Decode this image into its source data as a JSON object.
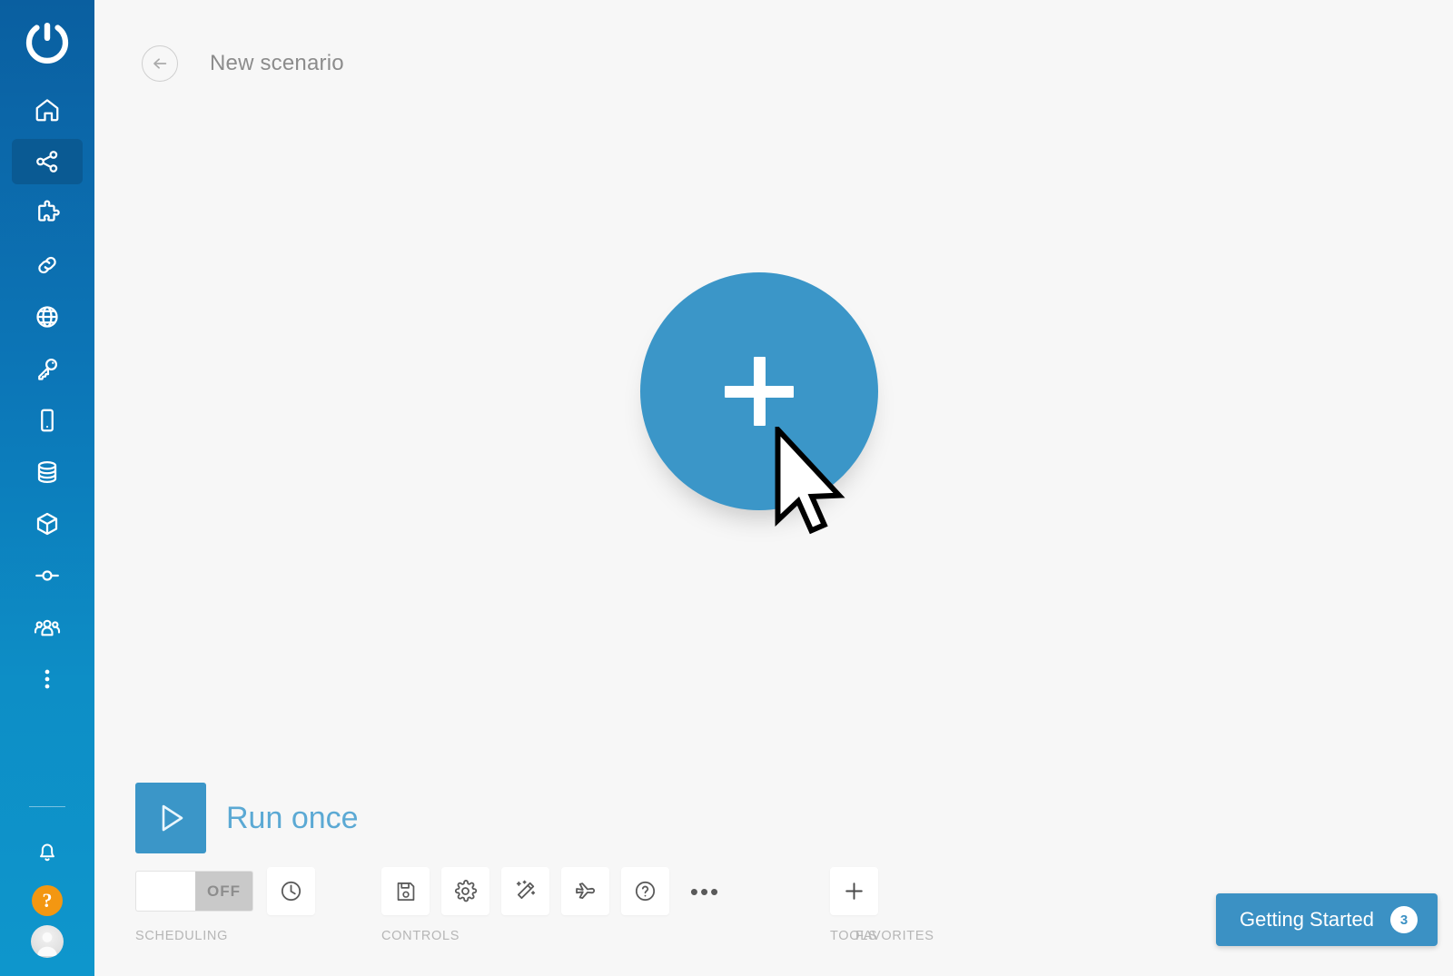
{
  "colors": {
    "brand_blue": "#0c77b8",
    "accent_blue": "#3b96c8",
    "sidebar_active": "#0a5a93",
    "help_orange": "#f39711",
    "canvas_bg": "#f7f7f7",
    "muted_text": "#b6b6b6",
    "title_text": "#8c8c8c",
    "run_label": "#5ba9d4"
  },
  "sidebar": {
    "logo": "integromat-power-logo",
    "items": [
      {
        "name": "home",
        "icon": "home-icon",
        "active": false
      },
      {
        "name": "scenarios",
        "icon": "share-nodes-icon",
        "active": true
      },
      {
        "name": "templates",
        "icon": "puzzle-piece-icon",
        "active": false
      },
      {
        "name": "connections",
        "icon": "link-icon",
        "active": false
      },
      {
        "name": "webhooks",
        "icon": "globe-icon",
        "active": false
      },
      {
        "name": "keys",
        "icon": "key-icon",
        "active": false
      },
      {
        "name": "devices",
        "icon": "mobile-icon",
        "active": false
      },
      {
        "name": "data-stores",
        "icon": "database-icon",
        "active": false
      },
      {
        "name": "data-structures",
        "icon": "cube-icon",
        "active": false
      },
      {
        "name": "functions",
        "icon": "node-connector-icon",
        "active": false
      },
      {
        "name": "team",
        "icon": "users-icon",
        "active": false
      },
      {
        "name": "more",
        "icon": "vertical-dots-icon",
        "active": false
      }
    ],
    "bottom_items": [
      {
        "name": "notifications",
        "icon": "bell-icon"
      },
      {
        "name": "help",
        "icon": "question-mark-icon",
        "label": "?"
      },
      {
        "name": "profile",
        "icon": "user-avatar-icon"
      }
    ]
  },
  "header": {
    "back_icon": "arrow-left-circle-icon",
    "title": "New scenario"
  },
  "canvas": {
    "add_module_icon": "plus-icon",
    "cursor_icon": "mouse-pointer-cursor"
  },
  "bottombar": {
    "run": {
      "icon": "play-triangle-icon",
      "label": "Run once"
    },
    "scheduling": {
      "group_label": "SCHEDULING",
      "toggle_state": "OFF",
      "clock_icon": "clock-icon"
    },
    "controls": {
      "group_label": "CONTROLS",
      "buttons": [
        {
          "name": "save-button",
          "icon": "floppy-disk-icon"
        },
        {
          "name": "settings-button",
          "icon": "gear-icon"
        },
        {
          "name": "auto-align-button",
          "icon": "magic-wand-icon"
        },
        {
          "name": "explain-flow-button",
          "icon": "airplane-icon"
        },
        {
          "name": "help-button",
          "icon": "question-circle-icon"
        },
        {
          "name": "more-options-button",
          "icon": "ellipsis-icon"
        }
      ]
    },
    "tools": {
      "group_label": "TOOLS"
    },
    "favorites": {
      "group_label": "FAVORITES",
      "add_icon": "plus-icon"
    }
  },
  "getting_started": {
    "label": "Getting Started",
    "count": "3"
  }
}
